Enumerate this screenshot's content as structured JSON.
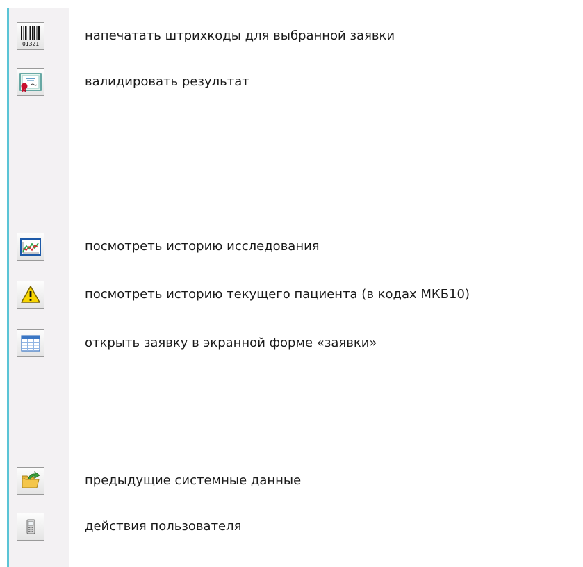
{
  "actions": [
    {
      "icon": "barcode-icon",
      "barcode_digits": "01321",
      "label": "напечатать штрихкоды для выбранной заявки"
    },
    {
      "icon": "certificate-icon",
      "label": "валидировать результат"
    },
    {
      "icon": "chart-history-icon",
      "label": "посмотреть историю исследования"
    },
    {
      "icon": "warning-icon",
      "label": "посмотреть историю текущего пациента (в кодах МКБ10)"
    },
    {
      "icon": "table-form-icon",
      "label": "открыть заявку в экранной форме «заявки»"
    },
    {
      "icon": "folder-arrow-icon",
      "label": "предыдущие системные данные"
    },
    {
      "icon": "mobile-phone-icon",
      "label": "действия пользователя"
    }
  ],
  "colors": {
    "toolbar_background": "#f3f1f3",
    "toolbar_accent": "#5bc4d6",
    "text": "#1a1a1a"
  }
}
